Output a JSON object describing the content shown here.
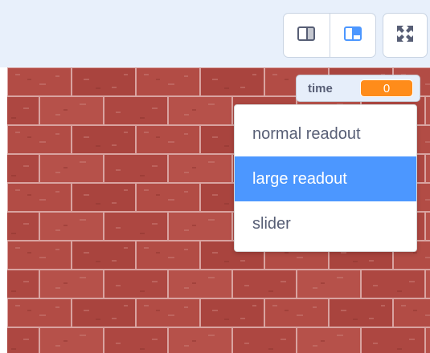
{
  "header": {
    "small_stage_button_icon": "small-stage-icon",
    "normal_stage_button_icon": "normal-stage-icon",
    "fullscreen_button_icon": "fullscreen-icon"
  },
  "monitor": {
    "label": "time",
    "value": "0"
  },
  "context_menu": {
    "items": [
      {
        "label": "normal readout",
        "selected": false
      },
      {
        "label": "large readout",
        "selected": true
      },
      {
        "label": "slider",
        "selected": false
      }
    ]
  },
  "colors": {
    "accent": "#4c97ff",
    "monitor_value": "#ff8c1a",
    "brick": "#b04a44",
    "mortar": "#d9a3a0"
  }
}
